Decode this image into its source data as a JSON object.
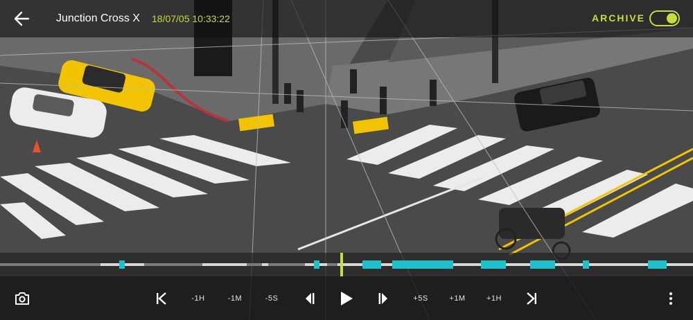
{
  "header": {
    "camera_name": "Junction Cross X",
    "timestamp": "18/07/05 10:33:22",
    "archive_label": "ARCHIVE",
    "archive_enabled": true
  },
  "icons": {
    "back": "arrow-left-icon",
    "snapshot": "camera-icon",
    "skip_start": "skip-to-start-icon",
    "step_back": "step-back-icon",
    "play": "play-icon",
    "step_forward": "step-forward-icon",
    "skip_end": "skip-to-end-icon",
    "more": "more-vertical-icon"
  },
  "controls": {
    "back_1h": "-1H",
    "back_1m": "-1M",
    "back_5s": "-5S",
    "fwd_5s": "+5S",
    "fwd_1m": "+1M",
    "fwd_1h": "+1H"
  },
  "colors": {
    "accent": "#c9dc3c",
    "recording": "#1fc0c9",
    "crosswalk_yellow": "#f2c400"
  }
}
